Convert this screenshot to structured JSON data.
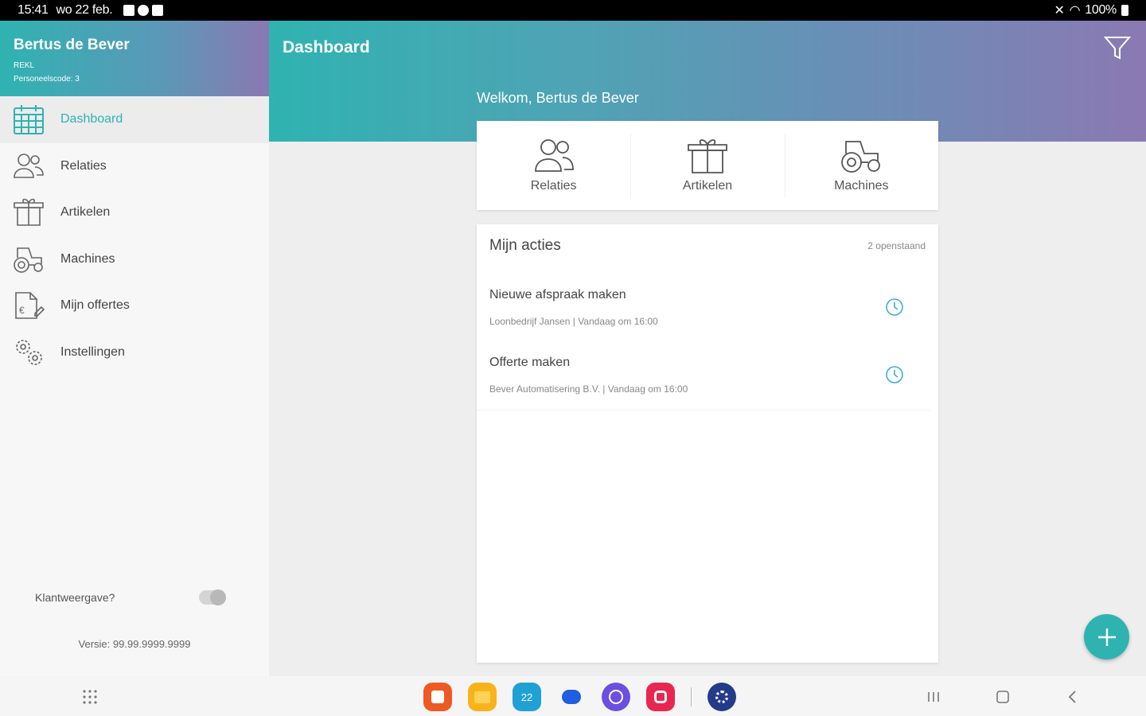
{
  "status_bar": {
    "time": "15:41",
    "date": "wo 22 feb.",
    "battery": "100%"
  },
  "sidebar": {
    "user_name": "Bertus de Bever",
    "role": "REKL",
    "staff_code": "Personeelscode: 3",
    "items": [
      {
        "label": "Dashboard",
        "icon": "calendar-icon",
        "active": true
      },
      {
        "label": "Relaties",
        "icon": "people-icon"
      },
      {
        "label": "Artikelen",
        "icon": "box-icon"
      },
      {
        "label": "Machines",
        "icon": "tractor-icon"
      },
      {
        "label": "Mijn offertes",
        "icon": "quote-document-icon"
      },
      {
        "label": "Instellingen",
        "icon": "gears-icon"
      }
    ],
    "client_view_label": "Klantweergave?",
    "client_view_on": false,
    "version": "Versie: 99.99.9999.9999"
  },
  "header": {
    "title": "Dashboard",
    "welcome": "Welkom, Bertus de Bever"
  },
  "quick_links": [
    {
      "label": "Relaties",
      "icon": "people-icon"
    },
    {
      "label": "Artikelen",
      "icon": "box-icon"
    },
    {
      "label": "Machines",
      "icon": "tractor-icon"
    }
  ],
  "actions": {
    "title": "Mijn acties",
    "count": "2 openstaand",
    "items": [
      {
        "title": "Nieuwe afspraak maken",
        "subtitle": "Loonbedrijf Jansen | Vandaag om 16:00"
      },
      {
        "title": "Offerte maken",
        "subtitle": "Bever Automatisering B.V. | Vandaag om 16:00"
      }
    ]
  },
  "colors": {
    "accent": "#2fb3b1",
    "gradient_end": "#8b79b3"
  },
  "taskbar": {
    "calendar_day": "22"
  }
}
